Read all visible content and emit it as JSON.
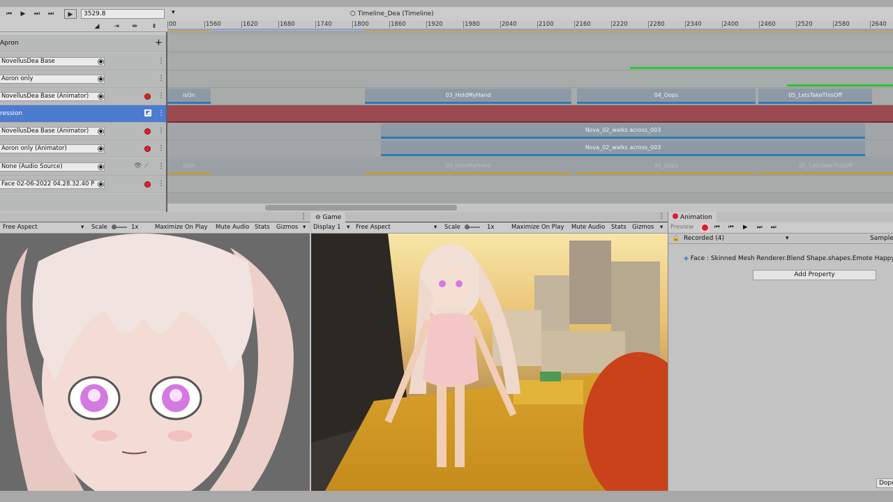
{
  "timeline": {
    "frame_value": "3529.8",
    "title": "Timeline_Dea (Timeline)",
    "ruler_ticks": [
      "00",
      "1560",
      "1620",
      "1680",
      "1740",
      "1800",
      "1860",
      "1920",
      "1980",
      "2040",
      "2100",
      "2160",
      "2220",
      "2280",
      "2340",
      "2400",
      "2460",
      "2520",
      "2580",
      "2640"
    ],
    "tracks": [
      {
        "label": "Apron",
        "kind": "group"
      },
      {
        "label": "NovellusDea Base",
        "kind": "field"
      },
      {
        "label": "Aoron  only",
        "kind": "field"
      },
      {
        "label": "NovellusDea Base (Animator)",
        "kind": "field"
      },
      {
        "label": "ression",
        "kind": "selected"
      },
      {
        "label": "NovellusDea Base (Animator)",
        "kind": "field"
      },
      {
        "label": "Aoron  only (Animator)",
        "kind": "field"
      },
      {
        "label": "None (Audio Source)",
        "kind": "field"
      },
      {
        "label": "Face 02-06-2022 04.28.32.40 P",
        "kind": "field"
      }
    ],
    "clips": {
      "row3": [
        "isOn",
        "03_HoldMyHand",
        "04_Oops",
        "05_LetsTakeThisOff"
      ],
      "row5": "Nova_02_walks across_003",
      "row6": "Nova_02_walks across_003",
      "row7": [
        "isOn",
        "03_HoldMyHand",
        "04_Oops",
        "05_LetsTakeThisOff"
      ]
    },
    "colors": {
      "selected": "#4d7bd0",
      "selected_clip": "#9a4a50",
      "record": "#d22233",
      "green_curve": "#2fc52f"
    }
  },
  "scene": {
    "aspect": "Free Aspect",
    "scale_label": "Scale",
    "scale_value": "1x",
    "maximize": "Maximize On Play",
    "mute": "Mute Audio",
    "stats": "Stats",
    "gizmos": "Gizmos"
  },
  "game": {
    "tab": "Game",
    "display": "Display 1",
    "aspect": "Free Aspect",
    "scale_label": "Scale",
    "scale_value": "1x",
    "maximize": "Maximize On Play",
    "mute": "Mute Audio",
    "stats": "Stats",
    "gizmos": "Gizmos"
  },
  "animation": {
    "tab": "Animation",
    "preview": "Preview",
    "clip_select": "Recorded (4)",
    "samples": "Sample",
    "property": "Face : Skinned Mesh Renderer.Blend Shape.shapes.Emote Happy",
    "add_property": "Add Property",
    "footer_button": "Dope"
  }
}
